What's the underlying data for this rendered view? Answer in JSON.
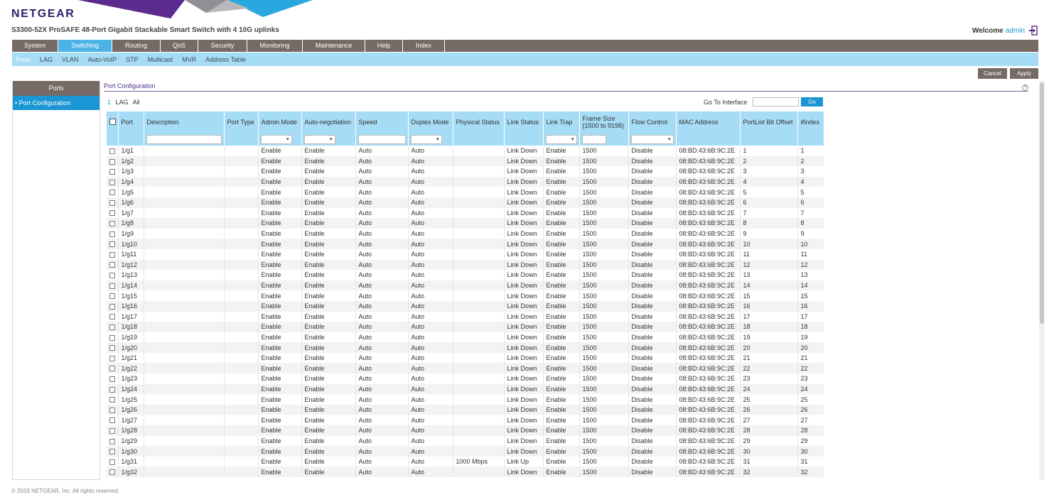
{
  "header": {
    "logo": "NETGEAR",
    "product": "S3300-52X ProSAFE 48-Port Gigabit Stackable Smart Switch with 4 10G uplinks",
    "welcome_label": "Welcome",
    "username": "admin",
    "logout_icon": "logout-icon"
  },
  "mainnav": [
    {
      "label": "System",
      "active": false
    },
    {
      "label": "Switching",
      "active": true
    },
    {
      "label": "Routing",
      "active": false
    },
    {
      "label": "QoS",
      "active": false
    },
    {
      "label": "Security",
      "active": false
    },
    {
      "label": "Monitoring",
      "active": false
    },
    {
      "label": "Maintenance",
      "active": false
    },
    {
      "label": "Help",
      "active": false
    },
    {
      "label": "Index",
      "active": false
    }
  ],
  "subnav": [
    {
      "label": "Ports",
      "active": true
    },
    {
      "label": "LAG",
      "active": false
    },
    {
      "label": "VLAN",
      "active": false
    },
    {
      "label": "Auto-VoIP",
      "active": false
    },
    {
      "label": "STP",
      "active": false
    },
    {
      "label": "Multicast",
      "active": false
    },
    {
      "label": "MVR",
      "active": false
    },
    {
      "label": "Address Table",
      "active": false
    }
  ],
  "actions": {
    "cancel": "Cancel",
    "apply": "Apply"
  },
  "sidenav": {
    "header": "Ports",
    "items": [
      "Port Configuration"
    ]
  },
  "content": {
    "title": "Port Configuration",
    "filters": [
      {
        "label": "1",
        "active": true
      },
      {
        "label": "LAG",
        "active": false
      },
      {
        "label": "All",
        "active": false
      }
    ],
    "goto_label": "Go To Interface",
    "goto_value": "",
    "go_button": "Go"
  },
  "table": {
    "columns": [
      "",
      "Port",
      "Description",
      "Port Type",
      "Admin Mode",
      "Auto-negotiation",
      "Speed",
      "Duplex Mode",
      "Physical Status",
      "Link Status",
      "Link Trap",
      "Frame Size (1500 to 9198)",
      "Flow Control",
      "MAC Address",
      "PortList Bit Offset",
      "ifIndex"
    ],
    "rows": [
      [
        "1/g1",
        "",
        "",
        "Enable",
        "Enable",
        "Auto",
        "Auto",
        "",
        "Link Down",
        "Enable",
        "1500",
        "Disable",
        "08:BD:43:6B:9C:2E",
        "1",
        "1"
      ],
      [
        "1/g2",
        "",
        "",
        "Enable",
        "Enable",
        "Auto",
        "Auto",
        "",
        "Link Down",
        "Enable",
        "1500",
        "Disable",
        "08:BD:43:6B:9C:2E",
        "2",
        "2"
      ],
      [
        "1/g3",
        "",
        "",
        "Enable",
        "Enable",
        "Auto",
        "Auto",
        "",
        "Link Down",
        "Enable",
        "1500",
        "Disable",
        "08:BD:43:6B:9C:2E",
        "3",
        "3"
      ],
      [
        "1/g4",
        "",
        "",
        "Enable",
        "Enable",
        "Auto",
        "Auto",
        "",
        "Link Down",
        "Enable",
        "1500",
        "Disable",
        "08:BD:43:6B:9C:2E",
        "4",
        "4"
      ],
      [
        "1/g5",
        "",
        "",
        "Enable",
        "Enable",
        "Auto",
        "Auto",
        "",
        "Link Down",
        "Enable",
        "1500",
        "Disable",
        "08:BD:43:6B:9C:2E",
        "5",
        "5"
      ],
      [
        "1/g6",
        "",
        "",
        "Enable",
        "Enable",
        "Auto",
        "Auto",
        "",
        "Link Down",
        "Enable",
        "1500",
        "Disable",
        "08:BD:43:6B:9C:2E",
        "6",
        "6"
      ],
      [
        "1/g7",
        "",
        "",
        "Enable",
        "Enable",
        "Auto",
        "Auto",
        "",
        "Link Down",
        "Enable",
        "1500",
        "Disable",
        "08:BD:43:6B:9C:2E",
        "7",
        "7"
      ],
      [
        "1/g8",
        "",
        "",
        "Enable",
        "Enable",
        "Auto",
        "Auto",
        "",
        "Link Down",
        "Enable",
        "1500",
        "Disable",
        "08:BD:43:6B:9C:2E",
        "8",
        "8"
      ],
      [
        "1/g9",
        "",
        "",
        "Enable",
        "Enable",
        "Auto",
        "Auto",
        "",
        "Link Down",
        "Enable",
        "1500",
        "Disable",
        "08:BD:43:6B:9C:2E",
        "9",
        "9"
      ],
      [
        "1/g10",
        "",
        "",
        "Enable",
        "Enable",
        "Auto",
        "Auto",
        "",
        "Link Down",
        "Enable",
        "1500",
        "Disable",
        "08:BD:43:6B:9C:2E",
        "10",
        "10"
      ],
      [
        "1/g11",
        "",
        "",
        "Enable",
        "Enable",
        "Auto",
        "Auto",
        "",
        "Link Down",
        "Enable",
        "1500",
        "Disable",
        "08:BD:43:6B:9C:2E",
        "11",
        "11"
      ],
      [
        "1/g12",
        "",
        "",
        "Enable",
        "Enable",
        "Auto",
        "Auto",
        "",
        "Link Down",
        "Enable",
        "1500",
        "Disable",
        "08:BD:43:6B:9C:2E",
        "12",
        "12"
      ],
      [
        "1/g13",
        "",
        "",
        "Enable",
        "Enable",
        "Auto",
        "Auto",
        "",
        "Link Down",
        "Enable",
        "1500",
        "Disable",
        "08:BD:43:6B:9C:2E",
        "13",
        "13"
      ],
      [
        "1/g14",
        "",
        "",
        "Enable",
        "Enable",
        "Auto",
        "Auto",
        "",
        "Link Down",
        "Enable",
        "1500",
        "Disable",
        "08:BD:43:6B:9C:2E",
        "14",
        "14"
      ],
      [
        "1/g15",
        "",
        "",
        "Enable",
        "Enable",
        "Auto",
        "Auto",
        "",
        "Link Down",
        "Enable",
        "1500",
        "Disable",
        "08:BD:43:6B:9C:2E",
        "15",
        "15"
      ],
      [
        "1/g16",
        "",
        "",
        "Enable",
        "Enable",
        "Auto",
        "Auto",
        "",
        "Link Down",
        "Enable",
        "1500",
        "Disable",
        "08:BD:43:6B:9C:2E",
        "16",
        "16"
      ],
      [
        "1/g17",
        "",
        "",
        "Enable",
        "Enable",
        "Auto",
        "Auto",
        "",
        "Link Down",
        "Enable",
        "1500",
        "Disable",
        "08:BD:43:6B:9C:2E",
        "17",
        "17"
      ],
      [
        "1/g18",
        "",
        "",
        "Enable",
        "Enable",
        "Auto",
        "Auto",
        "",
        "Link Down",
        "Enable",
        "1500",
        "Disable",
        "08:BD:43:6B:9C:2E",
        "18",
        "18"
      ],
      [
        "1/g19",
        "",
        "",
        "Enable",
        "Enable",
        "Auto",
        "Auto",
        "",
        "Link Down",
        "Enable",
        "1500",
        "Disable",
        "08:BD:43:6B:9C:2E",
        "19",
        "19"
      ],
      [
        "1/g20",
        "",
        "",
        "Enable",
        "Enable",
        "Auto",
        "Auto",
        "",
        "Link Down",
        "Enable",
        "1500",
        "Disable",
        "08:BD:43:6B:9C:2E",
        "20",
        "20"
      ],
      [
        "1/g21",
        "",
        "",
        "Enable",
        "Enable",
        "Auto",
        "Auto",
        "",
        "Link Down",
        "Enable",
        "1500",
        "Disable",
        "08:BD:43:6B:9C:2E",
        "21",
        "21"
      ],
      [
        "1/g22",
        "",
        "",
        "Enable",
        "Enable",
        "Auto",
        "Auto",
        "",
        "Link Down",
        "Enable",
        "1500",
        "Disable",
        "08:BD:43:6B:9C:2E",
        "22",
        "22"
      ],
      [
        "1/g23",
        "",
        "",
        "Enable",
        "Enable",
        "Auto",
        "Auto",
        "",
        "Link Down",
        "Enable",
        "1500",
        "Disable",
        "08:BD:43:6B:9C:2E",
        "23",
        "23"
      ],
      [
        "1/g24",
        "",
        "",
        "Enable",
        "Enable",
        "Auto",
        "Auto",
        "",
        "Link Down",
        "Enable",
        "1500",
        "Disable",
        "08:BD:43:6B:9C:2E",
        "24",
        "24"
      ],
      [
        "1/g25",
        "",
        "",
        "Enable",
        "Enable",
        "Auto",
        "Auto",
        "",
        "Link Down",
        "Enable",
        "1500",
        "Disable",
        "08:BD:43:6B:9C:2E",
        "25",
        "25"
      ],
      [
        "1/g26",
        "",
        "",
        "Enable",
        "Enable",
        "Auto",
        "Auto",
        "",
        "Link Down",
        "Enable",
        "1500",
        "Disable",
        "08:BD:43:6B:9C:2E",
        "26",
        "26"
      ],
      [
        "1/g27",
        "",
        "",
        "Enable",
        "Enable",
        "Auto",
        "Auto",
        "",
        "Link Down",
        "Enable",
        "1500",
        "Disable",
        "08:BD:43:6B:9C:2E",
        "27",
        "27"
      ],
      [
        "1/g28",
        "",
        "",
        "Enable",
        "Enable",
        "Auto",
        "Auto",
        "",
        "Link Down",
        "Enable",
        "1500",
        "Disable",
        "08:BD:43:6B:9C:2E",
        "28",
        "28"
      ],
      [
        "1/g29",
        "",
        "",
        "Enable",
        "Enable",
        "Auto",
        "Auto",
        "",
        "Link Down",
        "Enable",
        "1500",
        "Disable",
        "08:BD:43:6B:9C:2E",
        "29",
        "29"
      ],
      [
        "1/g30",
        "",
        "",
        "Enable",
        "Enable",
        "Auto",
        "Auto",
        "",
        "Link Down",
        "Enable",
        "1500",
        "Disable",
        "08:BD:43:6B:9C:2E",
        "30",
        "30"
      ],
      [
        "1/g31",
        "",
        "",
        "Enable",
        "Enable",
        "Auto",
        "Auto",
        "1000 Mbps",
        "Link Up",
        "Enable",
        "1500",
        "Disable",
        "08:BD:43:6B:9C:2E",
        "31",
        "31"
      ],
      [
        "1/g32",
        "",
        "",
        "Enable",
        "Enable",
        "Auto",
        "Auto",
        "",
        "Link Down",
        "Enable",
        "1500",
        "Disable",
        "08:BD:43:6B:9C:2E",
        "32",
        "32"
      ]
    ]
  },
  "footer": "© 2019 NETGEAR, Inc. All rights reserved.",
  "colors": {
    "nav_gray": "#766b64",
    "accent_blue": "#1a96d4",
    "light_blue": "#a6dcf5",
    "purple": "#4b2e83"
  }
}
